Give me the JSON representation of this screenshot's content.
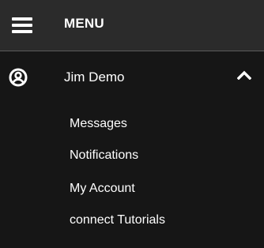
{
  "header": {
    "title": "MENU",
    "menu_icon": "hamburger-icon"
  },
  "user": {
    "name": "Jim Demo",
    "avatar_icon": "user-circle-icon",
    "toggle_icon": "chevron-up-icon",
    "expanded": true
  },
  "submenu": {
    "items": [
      {
        "label": "Messages"
      },
      {
        "label": "Notifications"
      },
      {
        "label": "My Account"
      },
      {
        "label": "connect Tutorials"
      }
    ]
  },
  "colors": {
    "background": "#161616",
    "header_background": "#2b2b2b",
    "divider": "#5a5a5a",
    "text": "#ffffff"
  }
}
